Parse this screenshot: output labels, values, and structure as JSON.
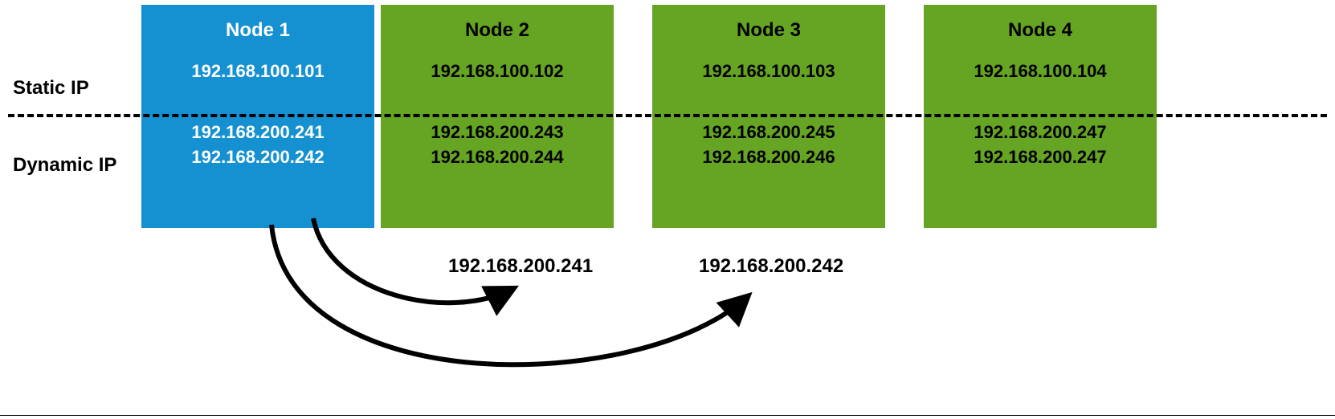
{
  "labels": {
    "static_ip": "Static IP",
    "dynamic_ip": "Dynamic IP"
  },
  "nodes": [
    {
      "title": "Node 1",
      "static_ip": "192.168.100.101",
      "dynamic_ip_1": "192.168.200.241",
      "dynamic_ip_2": "192.168.200.242",
      "primary": true
    },
    {
      "title": "Node 2",
      "static_ip": "192.168.100.102",
      "dynamic_ip_1": "192.168.200.243",
      "dynamic_ip_2": "192.168.200.244",
      "primary": false
    },
    {
      "title": "Node 3",
      "static_ip": "192.168.100.103",
      "dynamic_ip_1": "192.168.200.245",
      "dynamic_ip_2": "192.168.200.246",
      "primary": false
    },
    {
      "title": "Node 4",
      "static_ip": "192.168.100.104",
      "dynamic_ip_1": "192.168.200.247",
      "dynamic_ip_2": "192.168.200.247",
      "primary": false
    }
  ],
  "migrated_ips": {
    "to_node2": "192.168.200.241",
    "to_node3": "192.168.200.242"
  },
  "colors": {
    "primary_bg": "#1591d1",
    "secondary_bg": "#66a423"
  }
}
